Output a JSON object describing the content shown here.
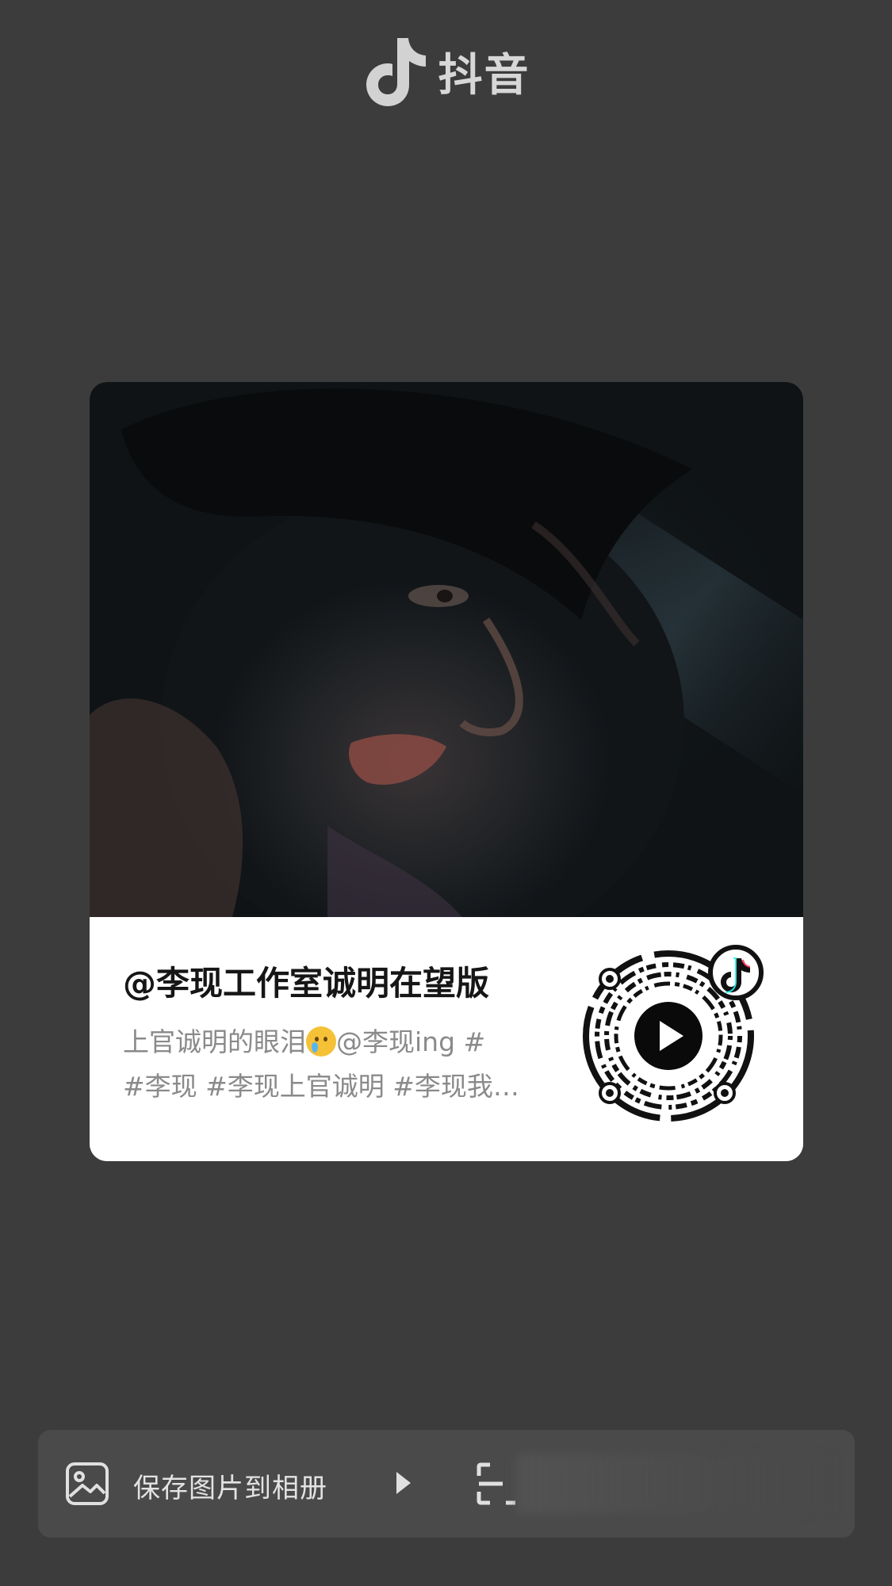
{
  "header": {
    "app_name": "抖音"
  },
  "card": {
    "author": "@李现工作室诚明在望版",
    "description_line1_before_emoji": "上官诚明的眼泪",
    "description_line1_after_emoji": "@李现ing #",
    "description_line2": "#李现 #李现上官诚明 #李现我…",
    "emoji": "crying-face"
  },
  "actions": {
    "save_label": "保存图片到相册"
  },
  "colors": {
    "background": "#3c3c3c",
    "card": "#ffffff",
    "action_bar": "#4a4a4a"
  }
}
